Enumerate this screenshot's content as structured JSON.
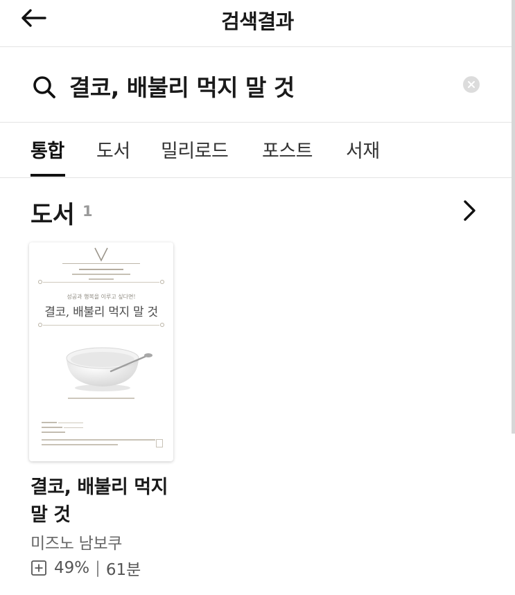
{
  "header": {
    "title": "검색결과",
    "back_icon": "arrow-left-icon"
  },
  "search": {
    "value": "결코, 배불리 먹지 말 것",
    "placeholder": "",
    "search_icon": "search-icon",
    "clear_icon": "clear-circle-icon"
  },
  "tabs": [
    {
      "label": "통합",
      "active": true
    },
    {
      "label": "도서",
      "active": false
    },
    {
      "label": "밀리로드",
      "active": false
    },
    {
      "label": "포스트",
      "active": false
    },
    {
      "label": "서재",
      "active": false
    }
  ],
  "section": {
    "title": "도서",
    "count": "1",
    "more_icon": "chevron-right-icon"
  },
  "book": {
    "title": "결코, 배불리 먹지 말 것",
    "author": "미즈노 남보쿠",
    "progress": "49%",
    "duration": "61분",
    "meta_icon": "plus-square-icon",
    "cover": {
      "tagline": "성공과 행복을 이루고 싶다면!",
      "title": "결코, 배불리 먹지 말 것"
    }
  },
  "colors": {
    "text": "#1a1a1a",
    "muted": "#666666",
    "divider": "#e3e3e3",
    "clear_bg": "#dcdcdc"
  }
}
